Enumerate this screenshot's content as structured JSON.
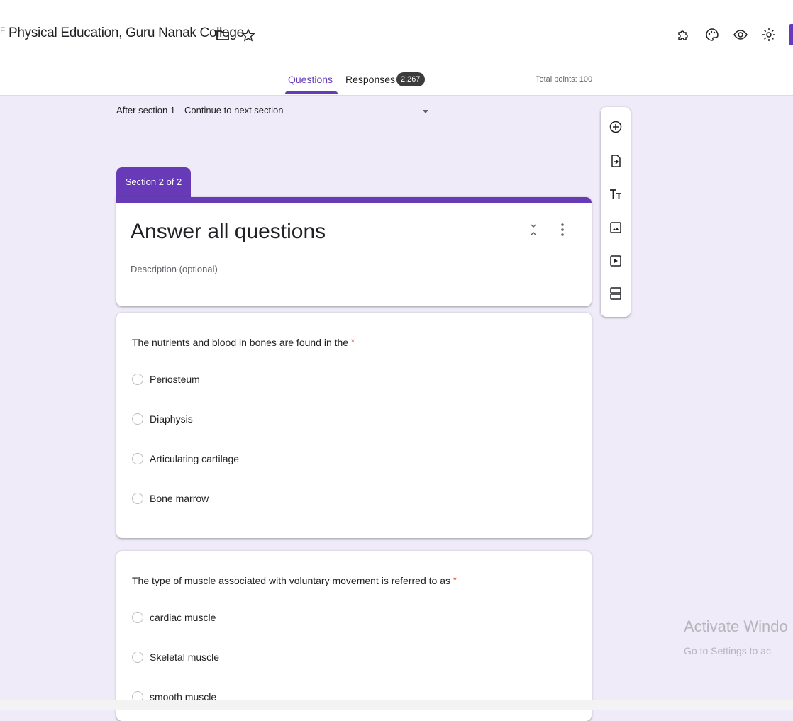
{
  "header": {
    "doc_title": "Physical Education, Guru Nanak College",
    "title_prefix": "F"
  },
  "tabs": {
    "questions": "Questions",
    "responses": "Responses",
    "responses_count": "2,267",
    "total_points": "Total points: 100"
  },
  "navigation": {
    "after_section_label": "After section 1",
    "after_section_value": "Continue to next section"
  },
  "section": {
    "tab_label": "Section 2 of 2",
    "title": "Answer all questions",
    "description_placeholder": "Description (optional)"
  },
  "questions": [
    {
      "text": "The nutrients and blood in bones are found in the",
      "required_mark": "*",
      "options": [
        "Periosteum",
        "Diaphysis",
        "Articulating cartilage",
        "Bone marrow"
      ]
    },
    {
      "text": "The type of muscle associated with voluntary movement is referred to as",
      "required_mark": "*",
      "options": [
        "cardiac muscle",
        "Skeletal muscle",
        "smooth muscle"
      ]
    }
  ],
  "watermark": {
    "line1": "Activate Windo",
    "line2": "Go to Settings to ac"
  },
  "colors": {
    "accent": "#673ab7",
    "background": "#efebf8",
    "required": "#d93025"
  },
  "icons": {
    "toolbar": [
      "add-question-icon",
      "import-questions-icon",
      "add-title-icon",
      "add-image-icon",
      "add-video-icon",
      "add-section-icon"
    ],
    "top_right": [
      "add-ons-icon",
      "palette-icon",
      "preview-icon",
      "settings-icon"
    ]
  }
}
